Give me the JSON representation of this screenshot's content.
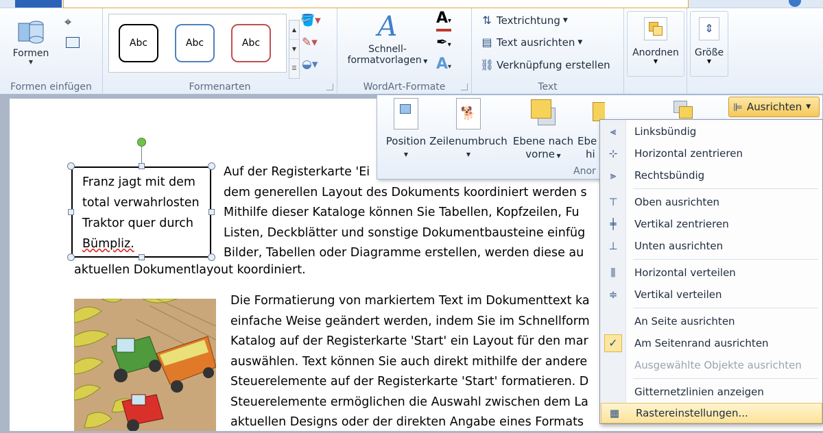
{
  "ribbon": {
    "formen_einfuegen": {
      "label": "Formen einfügen",
      "formen_button": "Formen"
    },
    "formenarten": {
      "label": "Formenarten",
      "swatch_text": "Abc"
    },
    "wordart": {
      "label": "WordArt-Formate",
      "schnell_line1": "Schnell-",
      "schnell_line2": "formatvorlagen"
    },
    "text": {
      "label": "Text",
      "textrichtung": "Textrichtung",
      "text_ausrichten": "Text ausrichten",
      "verknuepfung": "Verknüpfung erstellen"
    },
    "anordnen": "Anordnen",
    "groesse": "Größe"
  },
  "arrange_panel": {
    "position": "Position",
    "zeilenumbruch": "Zeilenumbruch",
    "ebene_vorne_line1": "Ebene nach",
    "ebene_vorne_line2": "vorne",
    "ebene_hinten_line1": "Ebe",
    "ebene_hinten_line2": "hi",
    "group_label": "Anor",
    "ausrichten": "Ausrichten"
  },
  "menu": {
    "items": [
      {
        "label": "Linksbündig",
        "icon": "align-left-icon"
      },
      {
        "label": "Horizontal zentrieren",
        "icon": "align-center-icon"
      },
      {
        "label": "Rechtsbündig",
        "icon": "align-right-icon"
      },
      {
        "label": "Oben ausrichten",
        "icon": "align-top-icon"
      },
      {
        "label": "Vertikal zentrieren",
        "icon": "align-middle-icon"
      },
      {
        "label": "Unten ausrichten",
        "icon": "align-bottom-icon"
      },
      {
        "label": "Horizontal verteilen",
        "icon": "distribute-horizontal-icon"
      },
      {
        "label": "Vertikal verteilen",
        "icon": "distribute-vertical-icon"
      },
      {
        "label": "An Seite ausrichten",
        "icon": ""
      },
      {
        "label": "Am Seitenrand ausrichten",
        "icon": "check-icon"
      },
      {
        "label": "Ausgewählte Objekte ausrichten",
        "icon": "",
        "disabled": true
      },
      {
        "label": "Gitternetzlinien anzeigen",
        "icon": ""
      },
      {
        "label": "Rastereinstellungen...",
        "icon": "grid-icon"
      }
    ]
  },
  "document": {
    "textbox_lines": [
      "Franz jagt mit dem",
      "total verwahrlosten",
      "Traktor quer durch",
      "Bümpliz."
    ],
    "para1": [
      "Auf der Registerkarte 'Ei",
      "dem generellen Layout des Dokuments koordiniert werden s",
      "Mithilfe dieser Kataloge können Sie Tabellen, Kopfzeilen, Fu",
      "Listen, Deckblätter und sonstige Dokumentbausteine einfüg",
      "Bilder, Tabellen oder Diagramme erstellen, werden diese au",
      "aktuellen Dokumentlayout koordiniert."
    ],
    "para2": [
      "Die Formatierung von markiertem Text im Dokumenttext ka",
      "einfache Weise geändert werden, indem Sie im Schnellform",
      "Katalog auf der Registerkarte 'Start' ein Layout für den mar",
      "auswählen. Text können Sie auch direkt mithilfe der andere",
      "Steuerelemente auf der Registerkarte 'Start' formatieren. D",
      "Steuerelemente ermöglichen die Auswahl zwischen dem La",
      "aktuellen Designs oder der direkten Angabe eines Formats"
    ]
  }
}
